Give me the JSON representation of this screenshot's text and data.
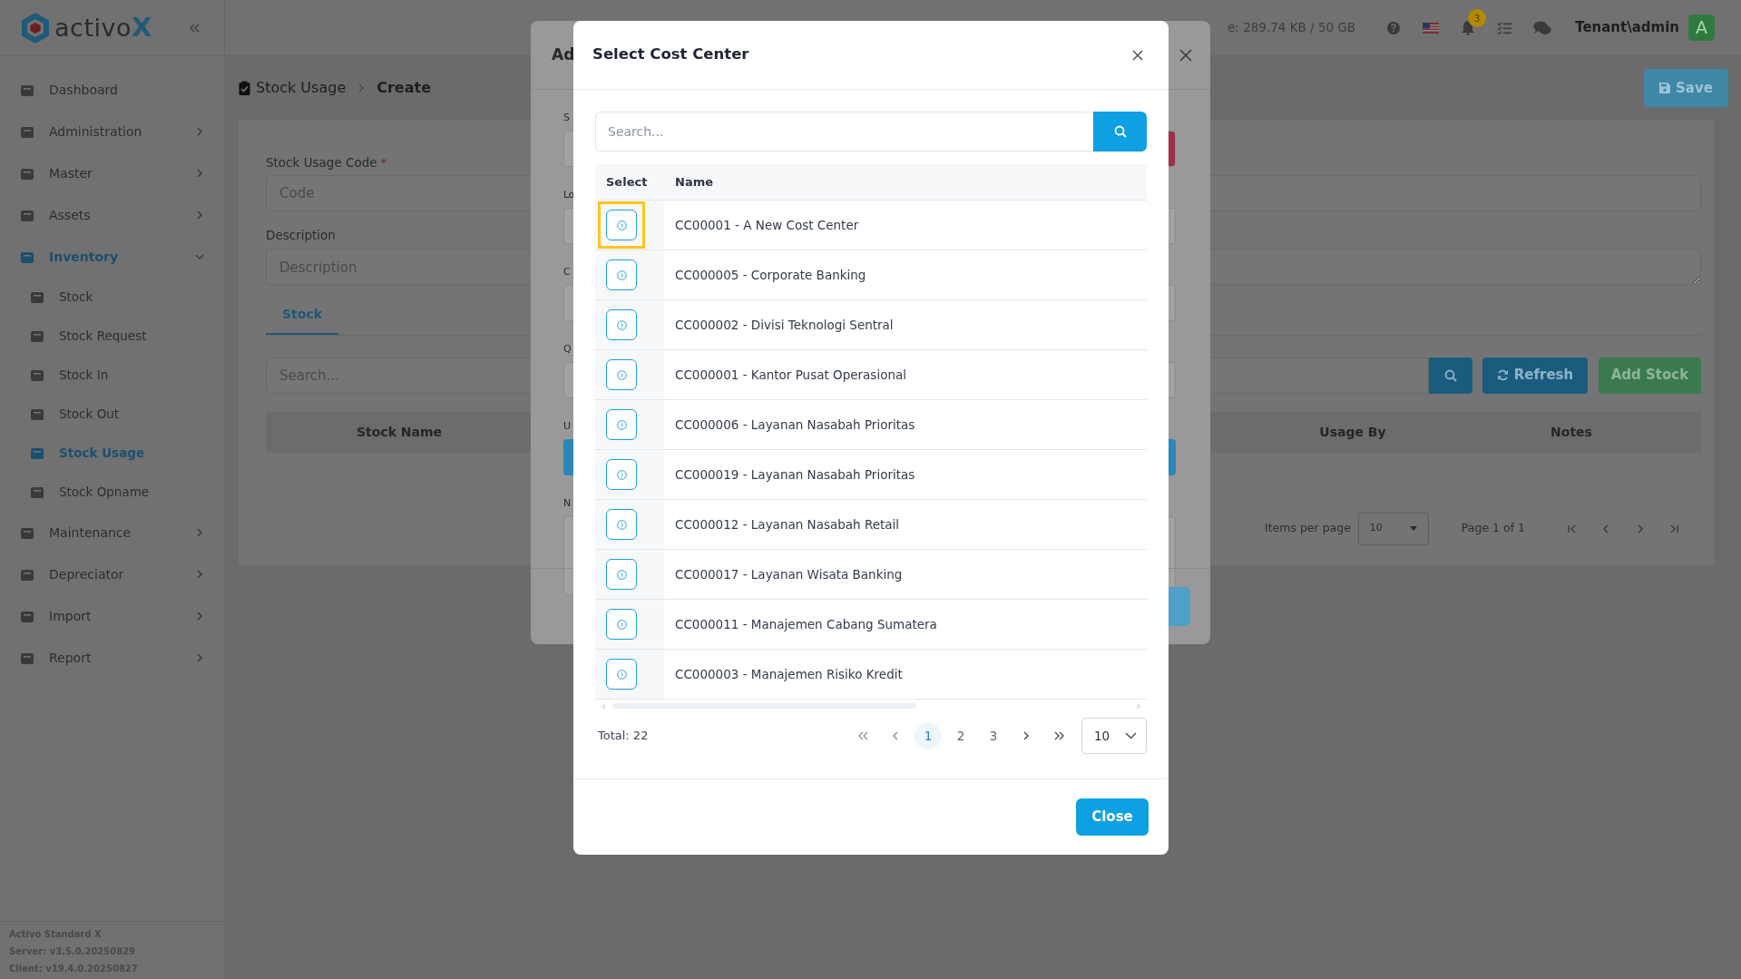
{
  "sidebar": {
    "logo": {
      "text": "activo",
      "accent": "X"
    },
    "items": [
      {
        "label": "Dashboard",
        "kind": "link",
        "selected": false
      },
      {
        "label": "Administration",
        "kind": "group",
        "expanded": false,
        "selected": false
      },
      {
        "label": "Master",
        "kind": "group",
        "expanded": false,
        "selected": false
      },
      {
        "label": "Assets",
        "kind": "group",
        "expanded": false,
        "selected": false
      },
      {
        "label": "Inventory",
        "kind": "group",
        "expanded": true,
        "selected": true,
        "children": [
          {
            "label": "Stock",
            "selected": false
          },
          {
            "label": "Stock Request",
            "selected": false
          },
          {
            "label": "Stock In",
            "selected": false
          },
          {
            "label": "Stock Out",
            "selected": false
          },
          {
            "label": "Stock Usage",
            "selected": true
          },
          {
            "label": "Stock Opname",
            "selected": false
          }
        ]
      },
      {
        "label": "Maintenance",
        "kind": "group",
        "expanded": false,
        "selected": false
      },
      {
        "label": "Depreciator",
        "kind": "group",
        "expanded": false,
        "selected": false
      },
      {
        "label": "Import",
        "kind": "group",
        "expanded": false,
        "selected": false
      },
      {
        "label": "Report",
        "kind": "group",
        "expanded": false,
        "selected": false
      }
    ],
    "footer": [
      "Activo Standard X",
      "Server: v3.5.0.20250829",
      "Client: v19.4.0.20250827"
    ]
  },
  "topbar": {
    "storage": "e: 289.74 KB / 50 GB",
    "notifications": "3",
    "user": "Tenant\\admin",
    "avatar": "A"
  },
  "breadcrumb": [
    "Stock Usage",
    "Create"
  ],
  "save_button": "Save",
  "form": {
    "code_label": "Stock Usage Code",
    "code_required_mark": "*",
    "code_placeholder": "Code",
    "description_label": "Description",
    "description_placeholder": "Description"
  },
  "tabs": [
    {
      "label": "Stock",
      "selected": true
    }
  ],
  "stock_table": {
    "search_placeholder": "Search...",
    "refresh_button": "Refresh",
    "add_button": "Add Stock",
    "columns": [
      "Stock Name",
      "Usage By",
      "Notes"
    ],
    "items_per_page_label": "Items per page",
    "items_per_page": "10",
    "page_info": "Page 1 of 1"
  },
  "add_dialog": {
    "title": "Ad",
    "fields": [
      {
        "label": "S",
        "kind": "danger-button"
      },
      {
        "label": "Lo",
        "kind": "input"
      },
      {
        "label": "C",
        "kind": "input"
      },
      {
        "label": "Q",
        "kind": "input"
      },
      {
        "label": "U",
        "kind": "primary-button"
      },
      {
        "label": "N",
        "kind": "textarea"
      }
    ]
  },
  "cost_center_dialog": {
    "title": "Select Cost Center",
    "search_placeholder": "Search...",
    "columns": [
      "Select",
      "Name"
    ],
    "rows": [
      {
        "name": "CC00001 - A New Cost Center",
        "highlighted": true
      },
      {
        "name": "CC000005 - Corporate Banking",
        "highlighted": false
      },
      {
        "name": "CC000002 - Divisi Teknologi Sentral",
        "highlighted": false
      },
      {
        "name": "CC000001 - Kantor Pusat Operasional",
        "highlighted": false
      },
      {
        "name": "CC000006 - Layanan Nasabah Prioritas",
        "highlighted": false
      },
      {
        "name": "CC000019 - Layanan Nasabah Prioritas",
        "highlighted": false
      },
      {
        "name": "CC000012 - Layanan Nasabah Retail",
        "highlighted": false
      },
      {
        "name": "CC000017 - Layanan Wisata Banking",
        "highlighted": false
      },
      {
        "name": "CC000011 - Manajemen Cabang Sumatera",
        "highlighted": false
      },
      {
        "name": "CC000003 - Manajemen Risiko Kredit",
        "highlighted": false
      }
    ],
    "total": "Total: 22",
    "pages": [
      {
        "label": "1",
        "selected": true
      },
      {
        "label": "2",
        "selected": false
      },
      {
        "label": "3",
        "selected": false
      }
    ],
    "page_size": "10",
    "close_button": "Close"
  }
}
